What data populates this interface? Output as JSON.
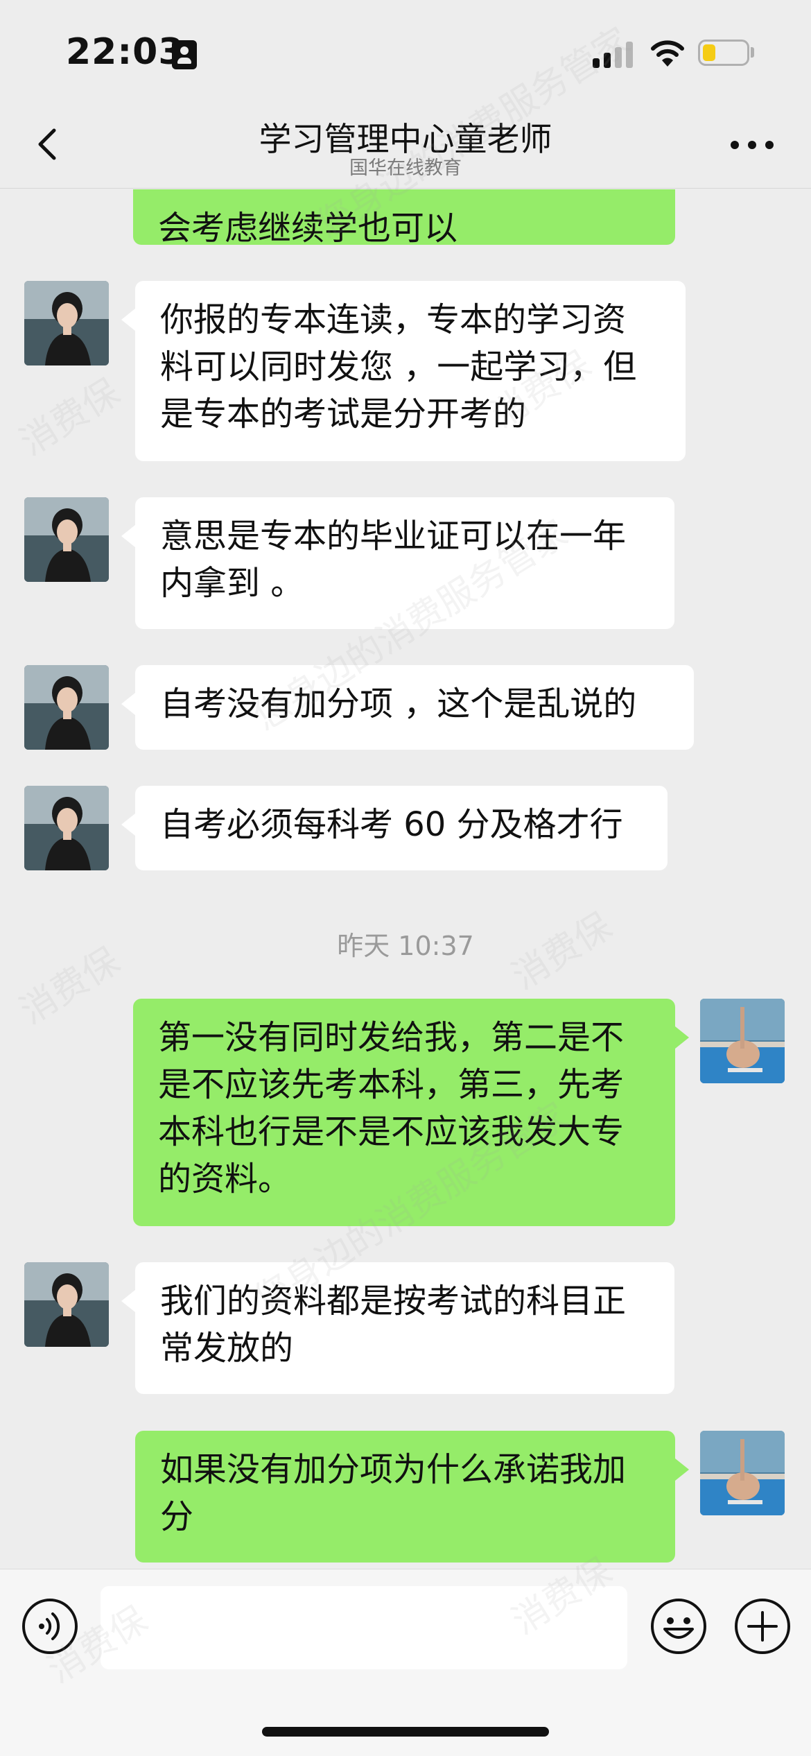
{
  "status_bar": {
    "time": "22:03"
  },
  "header": {
    "title": "学习管理中心童老师",
    "subtitle": "国华在线教育"
  },
  "messages": [
    {
      "from": "me",
      "text": "会考虑继续学也可以"
    },
    {
      "from": "other",
      "text": "你报的专本连读，专本的学习资\n料可以同时发您 ，一起学习，但\n是专本的考试是分开考的"
    },
    {
      "from": "other",
      "text": "意思是专本的毕业证可以在一年\n内拿到 。"
    },
    {
      "from": "other",
      "text": "自考没有加分项 ，这个是乱说的"
    },
    {
      "from": "other",
      "text": "自考必须每科考 60 分及格才行"
    },
    {
      "type": "time",
      "text": "昨天 10:37"
    },
    {
      "from": "me",
      "text": "第一没有同时发给我，第二是不\n是不应该先考本科，第三，先考\n本科也行是不是不应该我发大专\n的资料。"
    },
    {
      "from": "other",
      "text": "我们的资料都是按考试的科目正\n常发放的"
    },
    {
      "from": "me",
      "text": "如果没有加分项为什么承诺我加\n分"
    }
  ],
  "watermark_text": [
    "消费保",
    "您身边的消费服务管家"
  ],
  "colors": {
    "background": "#ededed",
    "incoming_bubble": "#ffffff",
    "outgoing_bubble": "#95ec69",
    "battery": "#f5cc15"
  },
  "icons": {
    "back": "chevron-left-icon",
    "more": "more-dots-icon",
    "voice": "voice-icon",
    "emoji": "emoji-icon",
    "plus": "plus-icon"
  }
}
